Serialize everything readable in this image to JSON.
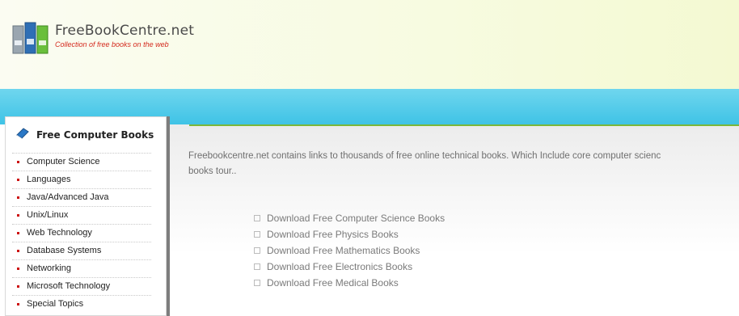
{
  "header": {
    "site_name": "FreeBookCentre.net",
    "tagline": "Collection of free books on the web"
  },
  "sidebar": {
    "title": "Free Computer Books",
    "items": [
      {
        "label": "Computer Science"
      },
      {
        "label": "Languages"
      },
      {
        "label": "Java/Advanced Java"
      },
      {
        "label": "Unix/Linux"
      },
      {
        "label": "Web Technology"
      },
      {
        "label": "Database Systems"
      },
      {
        "label": "Networking"
      },
      {
        "label": "Microsoft Technology"
      },
      {
        "label": "Special Topics"
      }
    ]
  },
  "main": {
    "intro_line1": "Freebookcentre.net contains links to thousands of free online technical books. Which Include core computer scienc",
    "intro_line2": "books tour..",
    "downloads": [
      {
        "label": "Download Free Computer Science Books"
      },
      {
        "label": "Download Free Physics Books"
      },
      {
        "label": "Download Free Mathematics Books"
      },
      {
        "label": "Download Free Electronics Books"
      },
      {
        "label": "Download Free Medical Books"
      }
    ]
  },
  "colors": {
    "nav_bar": "#3fc3e6",
    "accent_line": "#7bb73a",
    "tagline": "#d42a1d",
    "bullet": "#cc1111"
  }
}
